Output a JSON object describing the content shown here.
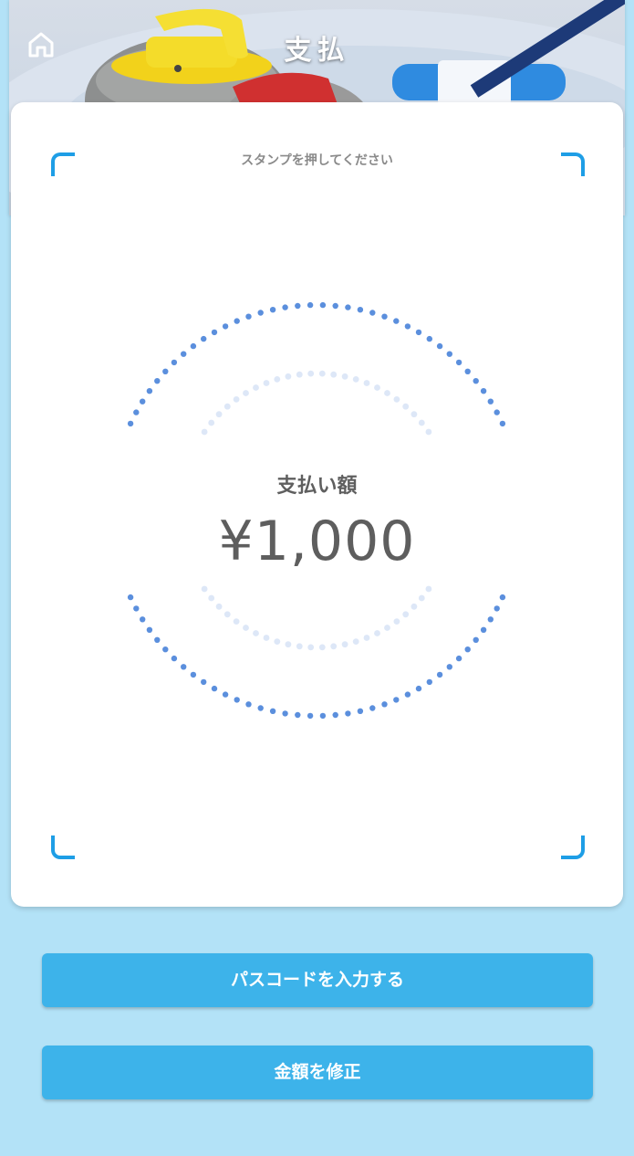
{
  "header": {
    "title": "支払",
    "home_icon": "home-icon"
  },
  "card": {
    "instruction": "スタンプを押してください",
    "amount_label": "支払い額",
    "amount_value": "¥1,000",
    "corner_color": "#1e9ee6",
    "outer_ring_color": "#5b8fdd",
    "inner_ring_color": "#dde7f7"
  },
  "buttons": {
    "passcode": "パスコードを入力する",
    "edit_amount": "金額を修正"
  },
  "colors": {
    "background": "#b3e2f7",
    "button": "#3db3ea"
  }
}
